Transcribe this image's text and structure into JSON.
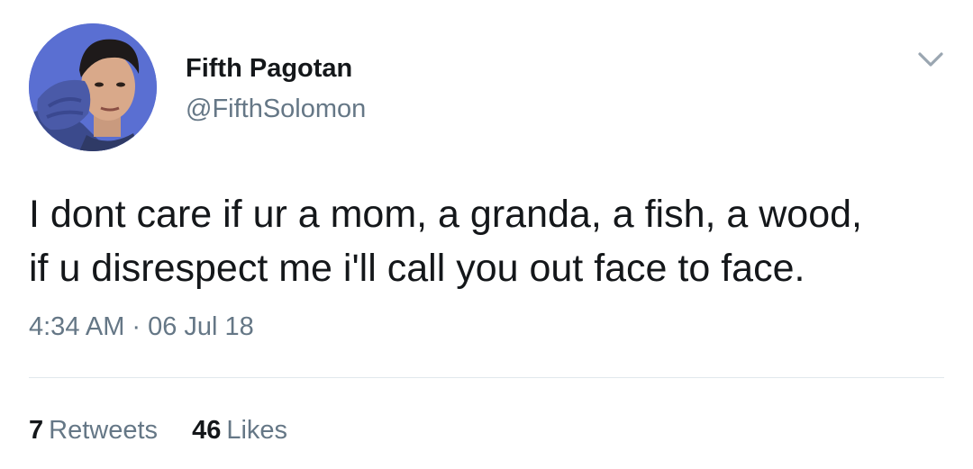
{
  "author": {
    "display_name": "Fifth Pagotan",
    "handle": "@FifthSolomon",
    "avatar_icon": "profile-photo"
  },
  "menu_icon": "chevron-down-icon",
  "tweet": {
    "lines": [
      "I dont care if ur a mom, a granda, a fish, a wood,",
      "if u disrespect me i'll call you out face to face."
    ]
  },
  "meta": {
    "time": "4:34 AM",
    "separator": "·",
    "date": "06 Jul 18"
  },
  "stats": {
    "retweets_count": "7",
    "retweets_label": "Retweets",
    "likes_count": "46",
    "likes_label": "Likes"
  },
  "colors": {
    "text": "#14171a",
    "secondary": "#657786",
    "divider": "#e1e8ed",
    "avatar_bg": "#5b6fd0"
  }
}
